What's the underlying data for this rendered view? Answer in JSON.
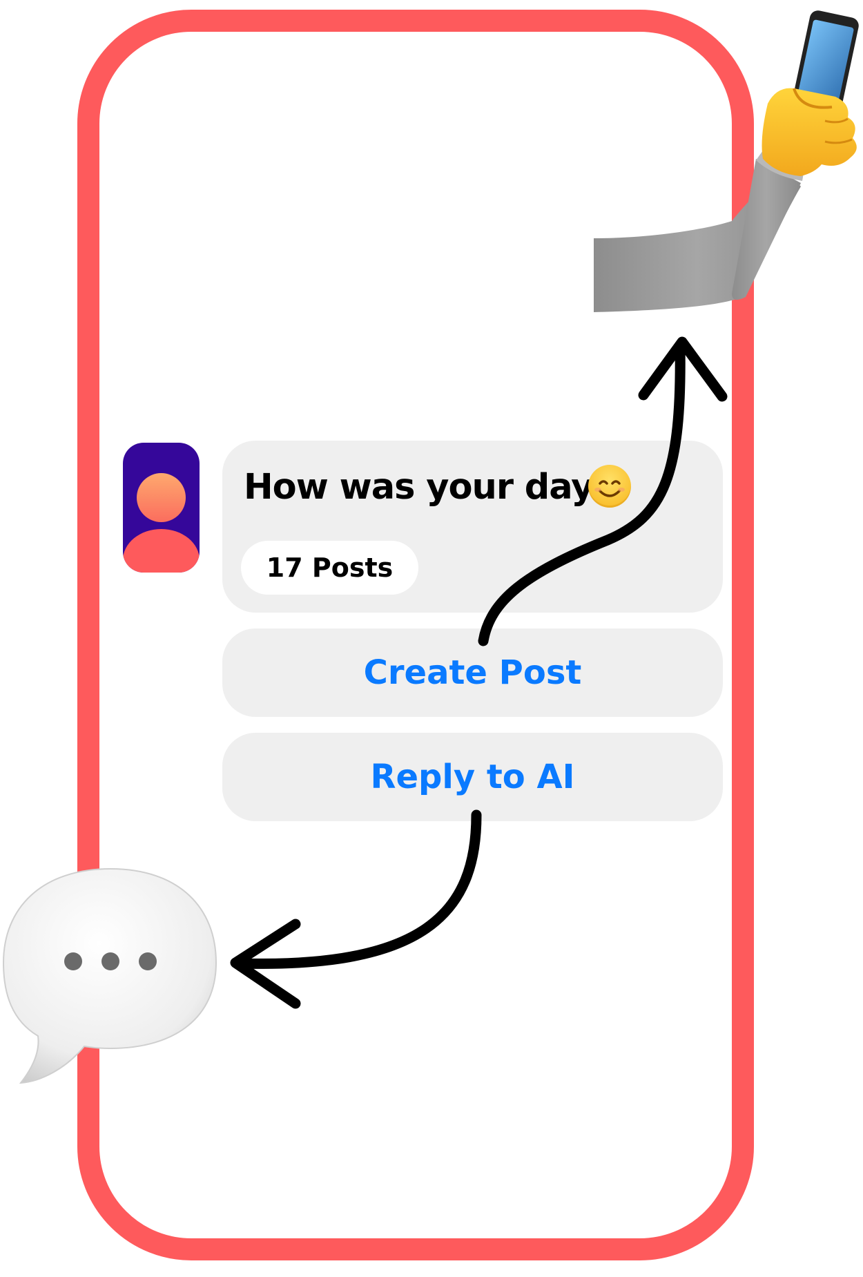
{
  "card": {
    "question": "How was your day?",
    "posts_label": "17 Posts"
  },
  "actions": {
    "create_post": "Create Post",
    "reply_to_ai": "Reply to AI"
  },
  "icons": {
    "avatar": "avatar-icon",
    "smile": "smiling-face-emoji",
    "selfie": "selfie-emoji",
    "speech_bubble": "speech-bubble-ellipsis-emoji"
  },
  "colors": {
    "frame": "#fe5a5c",
    "accent": "#0a7aff",
    "card": "#efefef",
    "avatar_bg": "#35079a"
  }
}
